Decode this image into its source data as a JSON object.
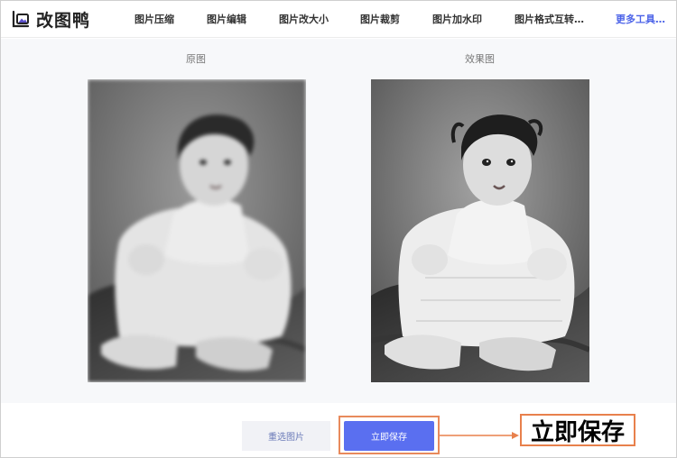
{
  "app": {
    "name": "改图鸭"
  },
  "nav": {
    "items": [
      {
        "label": "图片压缩"
      },
      {
        "label": "图片编辑"
      },
      {
        "label": "图片改大小"
      },
      {
        "label": "图片裁剪"
      },
      {
        "label": "图片加水印"
      },
      {
        "label": "图片格式互转…"
      }
    ],
    "more_label": "更多工具…"
  },
  "preview": {
    "original_label": "原图",
    "result_label": "效果图"
  },
  "actions": {
    "reselect_label": "重选图片",
    "save_label": "立即保存"
  },
  "annotation": {
    "callout_text": "立即保存"
  },
  "colors": {
    "accent": "#5a6ff0",
    "more_link": "#4c63e8",
    "annotation_border": "#e8804c",
    "canvas_bg": "#f7f8fa"
  },
  "icons": {
    "logo": "photo-mountain-icon",
    "more_caret": "chevron-down-icon",
    "annotation_arrow": "arrow-right-icon"
  }
}
